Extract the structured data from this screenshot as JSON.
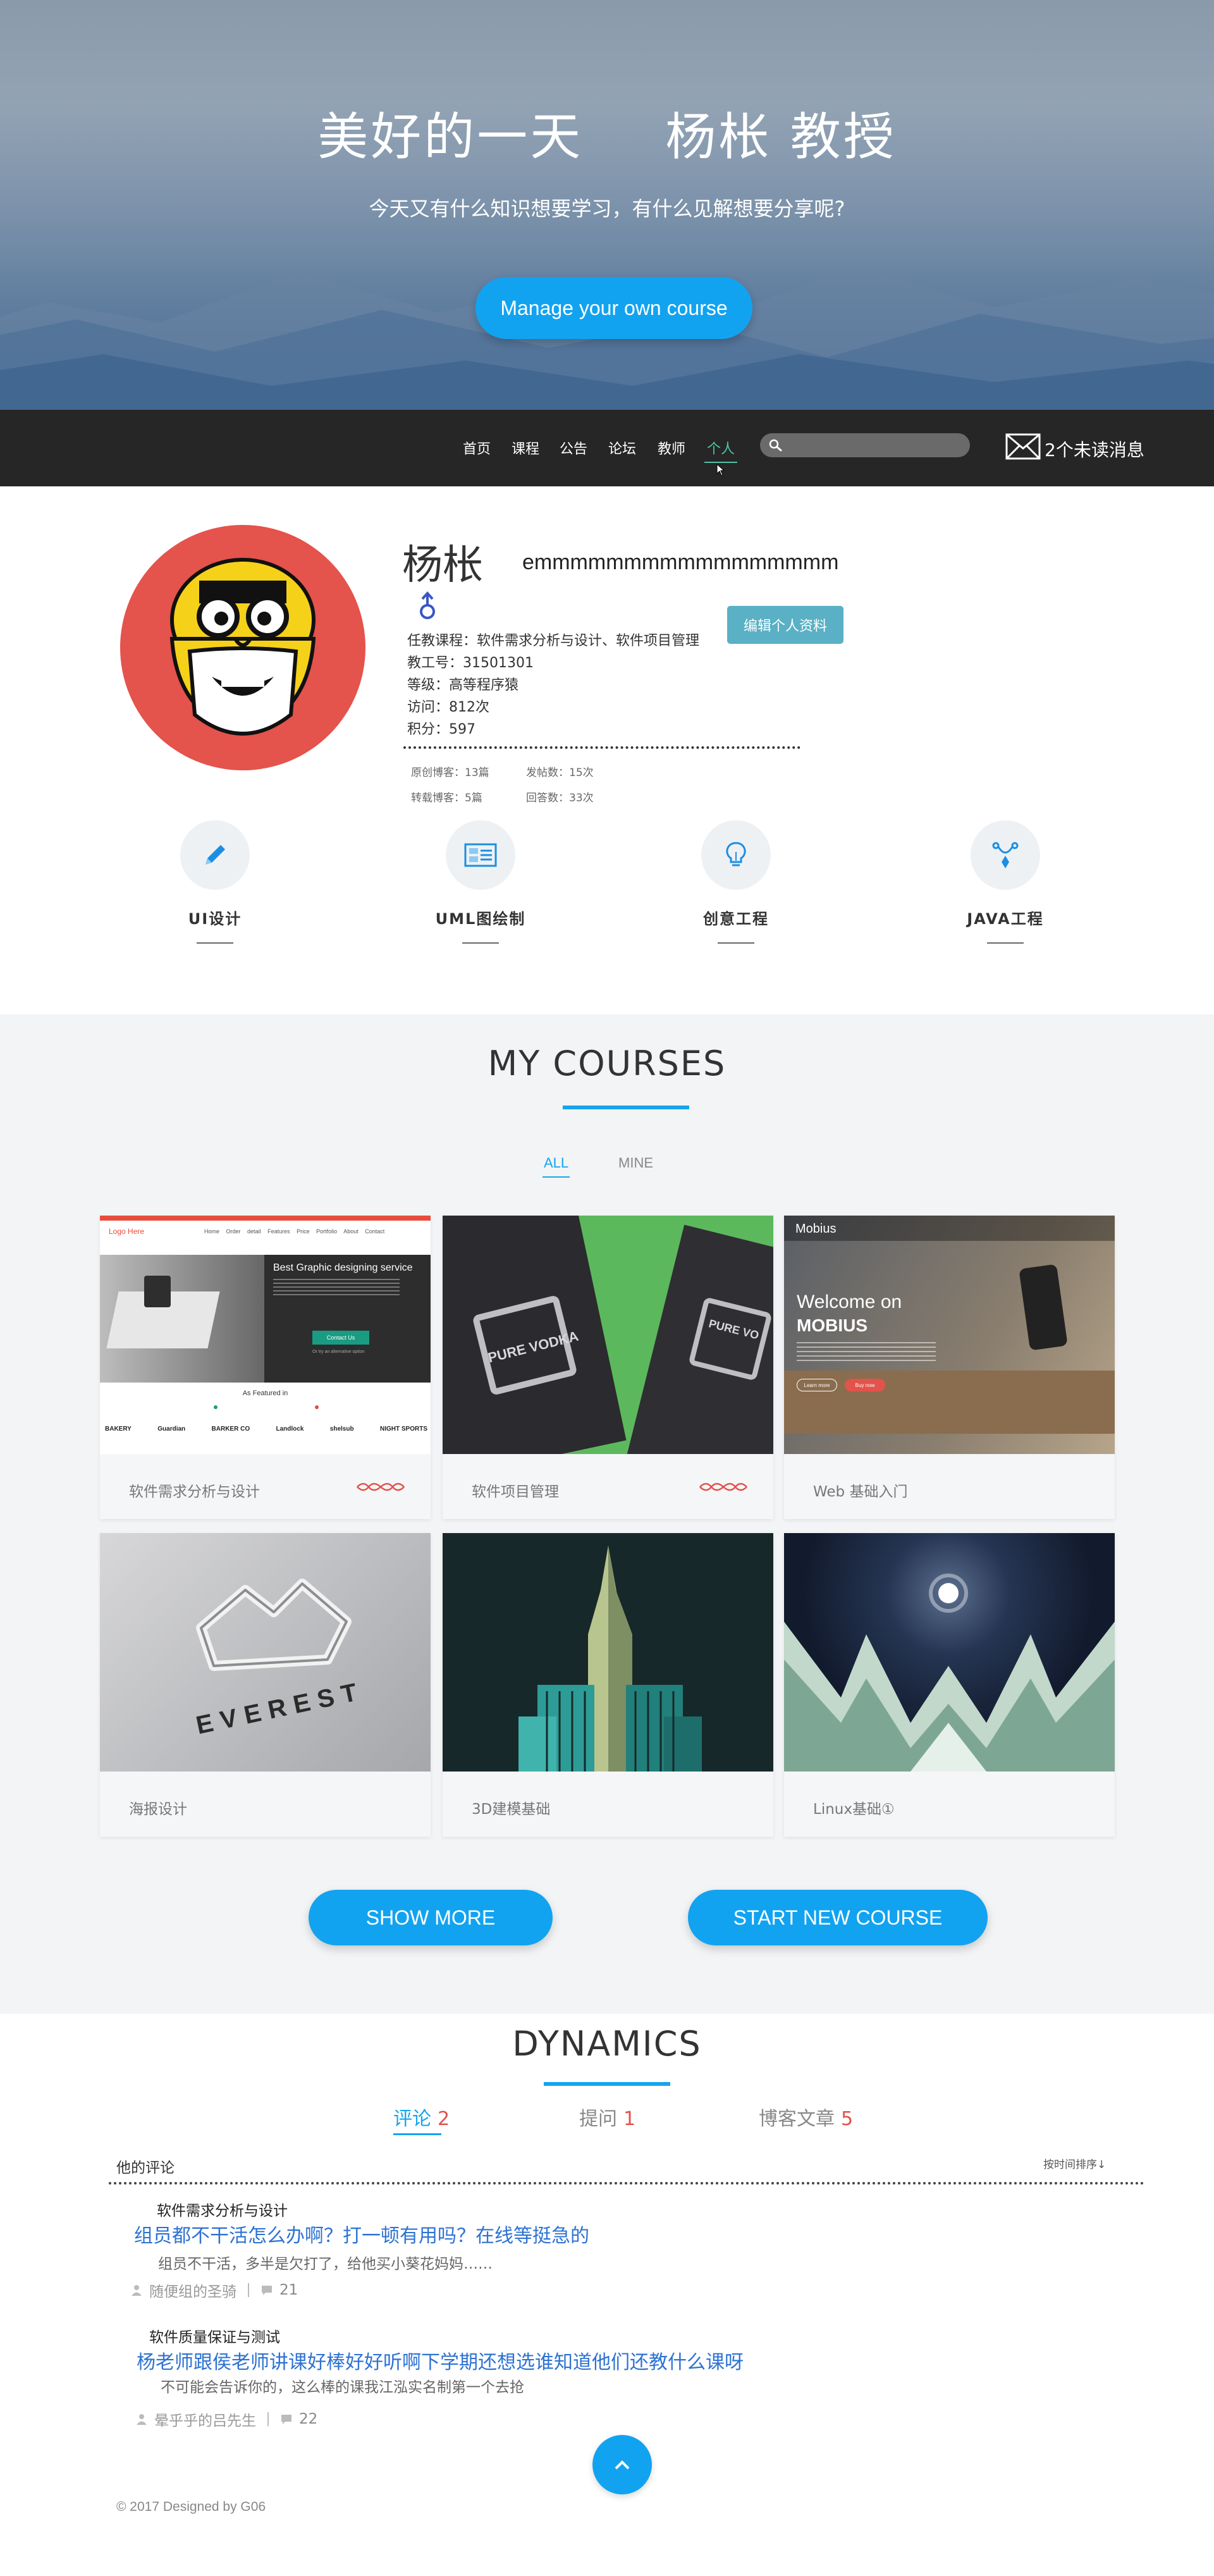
{
  "hero": {
    "title_left": "美好的一天",
    "title_right": "杨枨 教授",
    "subtitle": "今天又有什么知识想要学习，有什么见解想要分享呢?",
    "button": "Manage your own course"
  },
  "nav": {
    "items": [
      "首页",
      "课程",
      "公告",
      "论坛",
      "教师",
      "个人"
    ],
    "active": "个人",
    "search_placeholder": "",
    "messages": "2个未读消息"
  },
  "profile": {
    "name": "杨枨",
    "motto": "emmmmmmmmmmmmmmmmm",
    "courses": "任教课程：软件需求分析与设计、软件项目管理",
    "teacher_id": "教工号：31501301",
    "level": "等级：高等程序猿",
    "visits": "访问：812次",
    "points": "积分：597",
    "edit_button": "编辑个人资料",
    "stats": {
      "original": "原创博客：13篇",
      "posts": "发帖数：15次",
      "reposts": "转载博客：5篇",
      "answers": "回答数：33次"
    },
    "skills": [
      {
        "label": "UI设计",
        "icon": "pencil-icon"
      },
      {
        "label": "UML图绘制",
        "icon": "uml-diagram-icon"
      },
      {
        "label": "创意工程",
        "icon": "lightbulb-icon"
      },
      {
        "label": "JAVA工程",
        "icon": "vector-pen-icon"
      }
    ]
  },
  "courses": {
    "title": "MY COURSES",
    "filters": [
      "ALL",
      "MINE"
    ],
    "active_filter": "ALL",
    "cards": [
      {
        "title": "软件需求分析与设计",
        "deco": true,
        "thumb": {
          "logo": "Logo Here",
          "menu": [
            "Home",
            "Order detail",
            "Features",
            "Price",
            "Portfolio",
            "About",
            "Contact"
          ],
          "heading": "Best Graphic designing service",
          "cta": "Contact Us",
          "cta_alt": "Or try an alternative option",
          "featured": "As Featured in",
          "brands": [
            "BAKERY",
            "Guardian",
            "BARKER CO",
            "Landlock",
            "shelsub",
            "NIGHT SPORTS"
          ]
        }
      },
      {
        "title": "软件项目管理",
        "deco": true,
        "thumb": {
          "brand": "PURE VODKA",
          "brand_small": "PURE VO"
        }
      },
      {
        "title": "Web 基础入门",
        "deco": false,
        "thumb": {
          "brand": "Mobius",
          "welcome": "Welcome on",
          "product": "MOBIUS",
          "btn1": "Learn more",
          "btn2": "Buy now"
        }
      },
      {
        "title": "海报设计",
        "deco": false,
        "thumb": {
          "word": "EVEREST"
        }
      },
      {
        "title": "3D建模基础",
        "deco": false,
        "thumb": {}
      },
      {
        "title": "Linux基础①",
        "deco": false,
        "thumb": {}
      }
    ],
    "show_more": "SHOW MORE",
    "start_new": "START NEW COURSE"
  },
  "dynamics": {
    "title": "DYNAMICS",
    "tabs": [
      {
        "label": "评论",
        "count": "2"
      },
      {
        "label": "提问",
        "count": "1"
      },
      {
        "label": "博客文章",
        "count": "5"
      }
    ],
    "active_tab": "评论",
    "section_label": "他的评论",
    "sort": "按时间排序↓",
    "comments": [
      {
        "course": "软件需求分析与设计",
        "title": "组员都不干活怎么办啊？打一顿有用吗？在线等挺急的",
        "body": "组员不干活，多半是欠打了，给他买小葵花妈妈……",
        "author": "随便组的圣骑",
        "replies": "21"
      },
      {
        "course": "软件质量保证与测试",
        "title": "杨老师跟侯老师讲课好棒好好听啊下学期还想选谁知道他们还教什么课呀",
        "body": "不可能会告诉你的，这么棒的课我江泓实名制第一个去抢",
        "author": "晕乎乎的吕先生",
        "replies": "22"
      }
    ]
  },
  "footer": {
    "copyright": "© 2017 Designed by G06"
  },
  "colors": {
    "accent": "#12a3f0",
    "nav_bg": "#262626",
    "nav_active": "#51c1a3",
    "count_red": "#e2534b",
    "edit_btn": "#5ab0c4"
  }
}
